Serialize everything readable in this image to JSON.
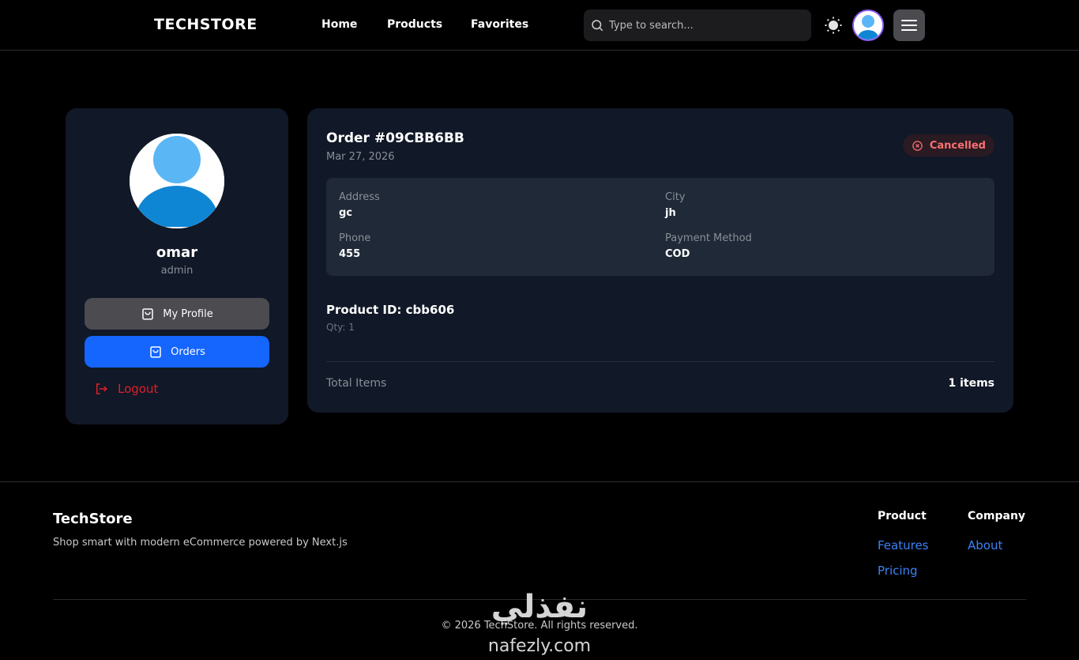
{
  "header": {
    "brand": "TECHSTORE",
    "nav": {
      "home": "Home",
      "products": "Products",
      "favorites": "Favorites"
    },
    "search_placeholder": "Type to search...",
    "icons": {
      "search": "search-icon",
      "theme": "sun-icon",
      "avatar": "user-avatar",
      "menu": "hamburger-menu-icon"
    },
    "avatar_ring_color": "#8b5cf6"
  },
  "sidebar": {
    "username": "omar",
    "role": "admin",
    "buttons": {
      "profile": "My Profile",
      "orders": "Orders",
      "logout": "Logout"
    },
    "active_color": "#1565ff",
    "logout_color": "#e11d2a"
  },
  "order": {
    "title": "Order #09CBB6BB",
    "date": "Mar 27, 2026",
    "status": "Cancelled",
    "status_color": "#f87171",
    "details": {
      "address_label": "Address",
      "address": "gc",
      "city_label": "City",
      "city": "jh",
      "phone_label": "Phone",
      "phone": "455",
      "payment_label": "Payment Method",
      "payment": "COD"
    },
    "product_id": "Product ID: cbb606",
    "qty": "Qty: 1",
    "total_label": "Total Items",
    "total_value": "1 items"
  },
  "footer": {
    "brand": "TechStore",
    "tagline": "Shop smart with modern eCommerce powered by Next.js",
    "columns": {
      "product": {
        "title": "Product",
        "links": [
          "Features",
          "Pricing"
        ]
      },
      "company": {
        "title": "Company",
        "links": [
          "About"
        ]
      }
    },
    "copyright": "© 2026 TechStore. All rights reserved.",
    "link_color": "#3b82f6"
  },
  "watermark": {
    "arabic": "نفذلي",
    "latin": "nafezly.com"
  }
}
